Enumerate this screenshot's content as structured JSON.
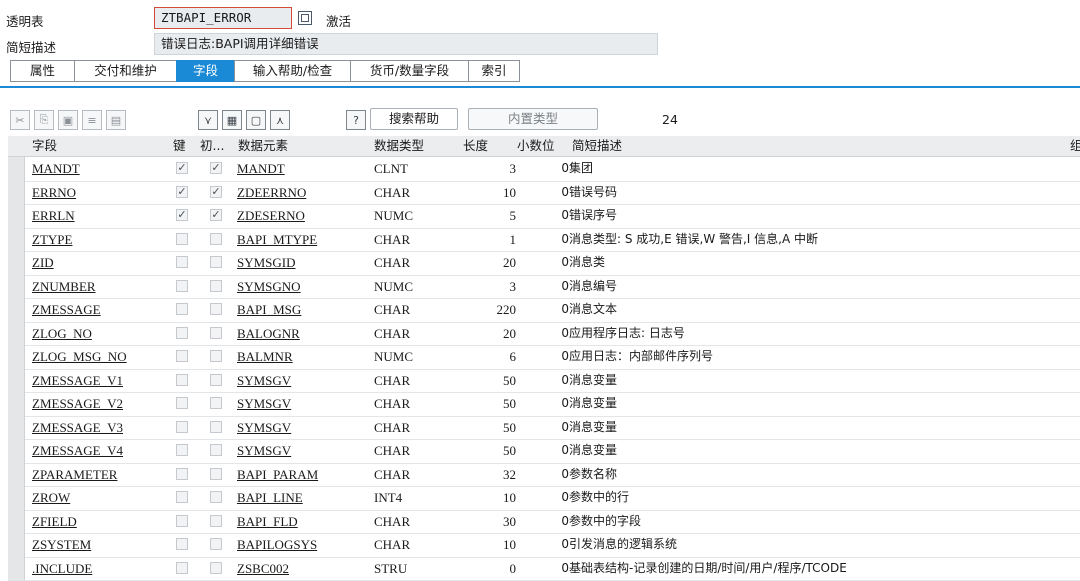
{
  "header": {
    "table_type_label": "透明表",
    "table_name": "ZTBAPI_ERROR",
    "status": "激活",
    "short_desc_label": "简短描述",
    "short_desc": "错误日志:BAPI调用详细错误"
  },
  "tabs": [
    {
      "label": "属性",
      "active": false
    },
    {
      "label": "交付和维护",
      "active": false
    },
    {
      "label": "字段",
      "active": true
    },
    {
      "label": "输入帮助/检查",
      "active": false
    },
    {
      "label": "货币/数量字段",
      "active": false
    },
    {
      "label": "索引",
      "active": false
    }
  ],
  "toolbar": {
    "search_help_label": "搜索帮助",
    "builtin_type_label": "内置类型",
    "field_count": "24"
  },
  "columns": {
    "field": "字段",
    "key": "键",
    "init": "初...",
    "data_element": "数据元素",
    "data_type": "数据类型",
    "length": "长度",
    "decimals": "小数位",
    "short_desc": "简短描述",
    "group": "组"
  },
  "rows": [
    {
      "field": "MANDT",
      "key": true,
      "init": true,
      "element": "MANDT",
      "type": "CLNT",
      "len": "3",
      "dec": "0",
      "desc": "集团"
    },
    {
      "field": "ERRNO",
      "key": true,
      "init": true,
      "element": "ZDEERRNO",
      "type": "CHAR",
      "len": "10",
      "dec": "0",
      "desc": "错误号码"
    },
    {
      "field": "ERRLN",
      "key": true,
      "init": true,
      "element": "ZDESERNO",
      "type": "NUMC",
      "len": "5",
      "dec": "0",
      "desc": "错误序号"
    },
    {
      "field": "ZTYPE",
      "key": false,
      "init": false,
      "element": "BAPI_MTYPE",
      "type": "CHAR",
      "len": "1",
      "dec": "0",
      "desc": "消息类型: S 成功,E 错误,W 警告,I 信息,A 中断"
    },
    {
      "field": "ZID",
      "key": false,
      "init": false,
      "element": "SYMSGID",
      "type": "CHAR",
      "len": "20",
      "dec": "0",
      "desc": "消息类"
    },
    {
      "field": "ZNUMBER",
      "key": false,
      "init": false,
      "element": "SYMSGNO",
      "type": "NUMC",
      "len": "3",
      "dec": "0",
      "desc": "消息编号"
    },
    {
      "field": "ZMESSAGE",
      "key": false,
      "init": false,
      "element": "BAPI_MSG",
      "type": "CHAR",
      "len": "220",
      "dec": "0",
      "desc": "消息文本"
    },
    {
      "field": "ZLOG_NO",
      "key": false,
      "init": false,
      "element": "BALOGNR",
      "type": "CHAR",
      "len": "20",
      "dec": "0",
      "desc": "应用程序日志: 日志号"
    },
    {
      "field": "ZLOG_MSG_NO",
      "key": false,
      "init": false,
      "element": "BALMNR",
      "type": "NUMC",
      "len": "6",
      "dec": "0",
      "desc": "应用日志：内部邮件序列号"
    },
    {
      "field": "ZMESSAGE_V1",
      "key": false,
      "init": false,
      "element": "SYMSGV",
      "type": "CHAR",
      "len": "50",
      "dec": "0",
      "desc": "消息变量"
    },
    {
      "field": "ZMESSAGE_V2",
      "key": false,
      "init": false,
      "element": "SYMSGV",
      "type": "CHAR",
      "len": "50",
      "dec": "0",
      "desc": "消息变量"
    },
    {
      "field": "ZMESSAGE_V3",
      "key": false,
      "init": false,
      "element": "SYMSGV",
      "type": "CHAR",
      "len": "50",
      "dec": "0",
      "desc": "消息变量"
    },
    {
      "field": "ZMESSAGE_V4",
      "key": false,
      "init": false,
      "element": "SYMSGV",
      "type": "CHAR",
      "len": "50",
      "dec": "0",
      "desc": "消息变量"
    },
    {
      "field": "ZPARAMETER",
      "key": false,
      "init": false,
      "element": "BAPI_PARAM",
      "type": "CHAR",
      "len": "32",
      "dec": "0",
      "desc": "参数名称"
    },
    {
      "field": "ZROW",
      "key": false,
      "init": false,
      "element": "BAPI_LINE",
      "type": "INT4",
      "len": "10",
      "dec": "0",
      "desc": "参数中的行"
    },
    {
      "field": "ZFIELD",
      "key": false,
      "init": false,
      "element": "BAPI_FLD",
      "type": "CHAR",
      "len": "30",
      "dec": "0",
      "desc": "参数中的字段"
    },
    {
      "field": "ZSYSTEM",
      "key": false,
      "init": false,
      "element": "BAPILOGSYS",
      "type": "CHAR",
      "len": "10",
      "dec": "0",
      "desc": "引发消息的逻辑系统"
    },
    {
      "field": ".INCLUDE",
      "key": false,
      "init": false,
      "element": "ZSBC002",
      "type": "STRU",
      "len": "0",
      "dec": "0",
      "desc": "基础表结构-记录创建的日期/时间/用户/程序/TCODE"
    }
  ],
  "colors": {
    "accent": "#1a8ad6",
    "field_bg": "#e9ecef",
    "header_bg": "#ecedee",
    "focus_border": "#d64a3a"
  },
  "icons": [
    "cut-icon",
    "copy-icon",
    "paste-icon",
    "insert-row-icon",
    "delete-row-icon",
    "collapse-icon",
    "select-all-icon",
    "deselect-icon",
    "expand-icon",
    "search-help-icon"
  ]
}
